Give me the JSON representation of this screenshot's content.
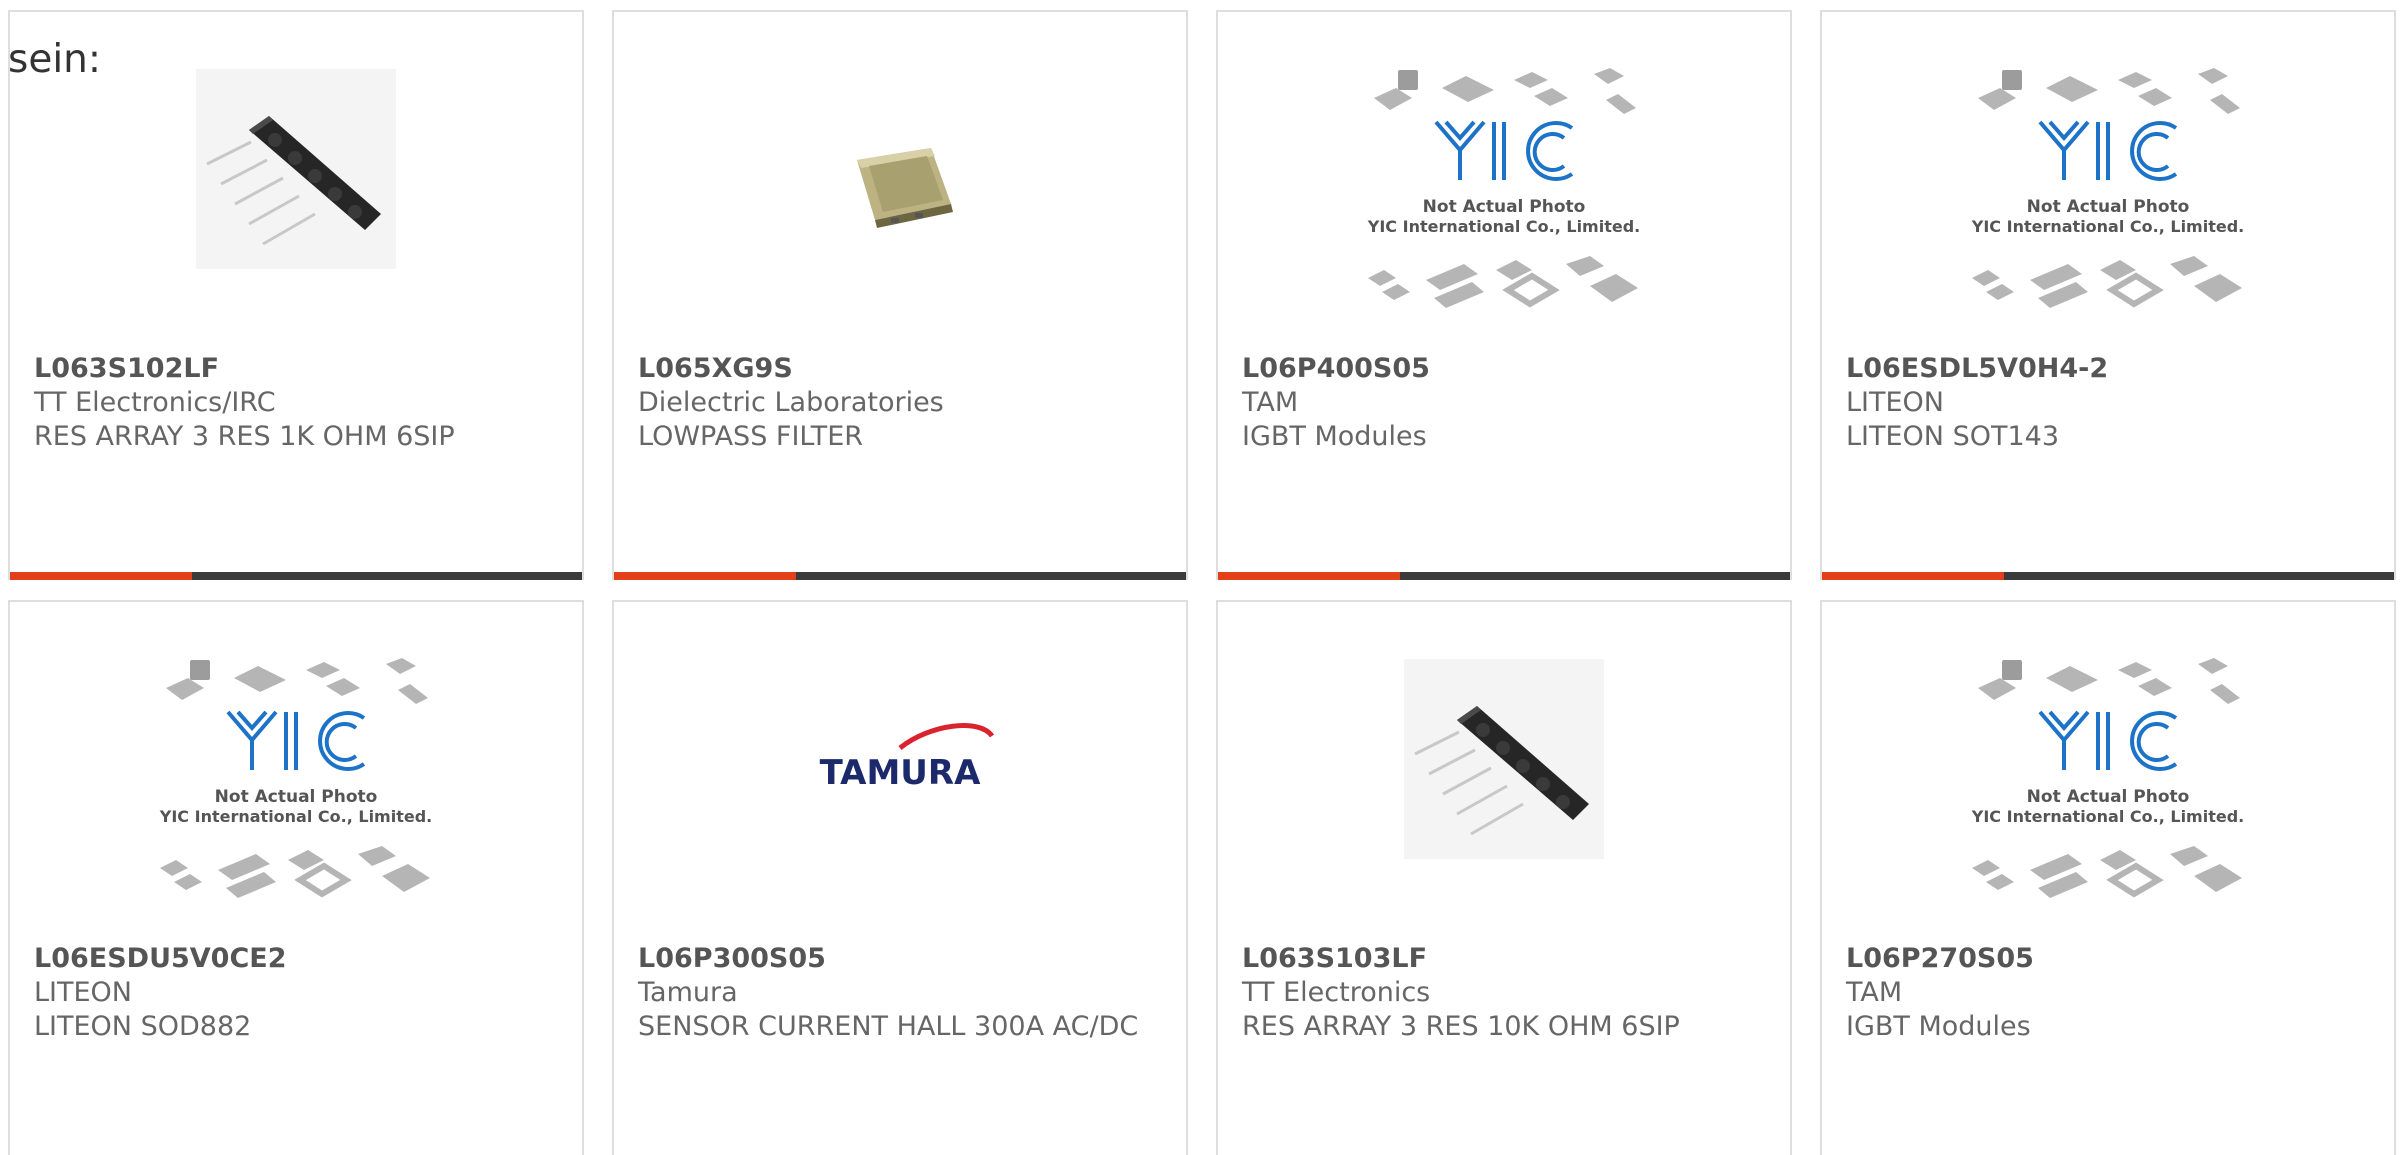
{
  "intro_text": "sein:",
  "colors": {
    "accent": "#e1401b",
    "bar": "#3a3a3a",
    "border": "#dedede",
    "text": "#666666",
    "yic_blue": "#1d73c8",
    "tamura_navy": "#1c2a6c",
    "tamura_red": "#d9232e"
  },
  "placeholder": {
    "brand": "YIC",
    "line1": "Not Actual Photo",
    "line2": "YIC International Co., Limited."
  },
  "tamura_logo": "TAMURA",
  "products": [
    {
      "part": "L063S102LF",
      "maker": "TT Electronics/IRC",
      "desc": "RES ARRAY 3 RES 1K OHM 6SIP",
      "image": "resistor-array-image"
    },
    {
      "part": "L065XG9S",
      "maker": "Dielectric Laboratories",
      "desc": "LOWPASS FILTER",
      "image": "gold-package-image"
    },
    {
      "part": "L06P400S05",
      "maker": "TAM",
      "desc": "IGBT Modules",
      "image": "yic-placeholder-image"
    },
    {
      "part": "L06ESDL5V0H4-2",
      "maker": "LITEON",
      "desc": "LITEON SOT143",
      "image": "yic-placeholder-image"
    },
    {
      "part": "L06ESDU5V0CE2",
      "maker": "LITEON",
      "desc": "LITEON SOD882",
      "image": "yic-placeholder-image"
    },
    {
      "part": "L06P300S05",
      "maker": "Tamura",
      "desc": "SENSOR CURRENT HALL 300A AC/DC",
      "image": "tamura-logo-image"
    },
    {
      "part": "L063S103LF",
      "maker": "TT Electronics",
      "desc": "RES ARRAY 3 RES 10K OHM 6SIP",
      "image": "resistor-array-image"
    },
    {
      "part": "L06P270S05",
      "maker": "TAM",
      "desc": "IGBT Modules",
      "image": "yic-placeholder-image"
    }
  ]
}
